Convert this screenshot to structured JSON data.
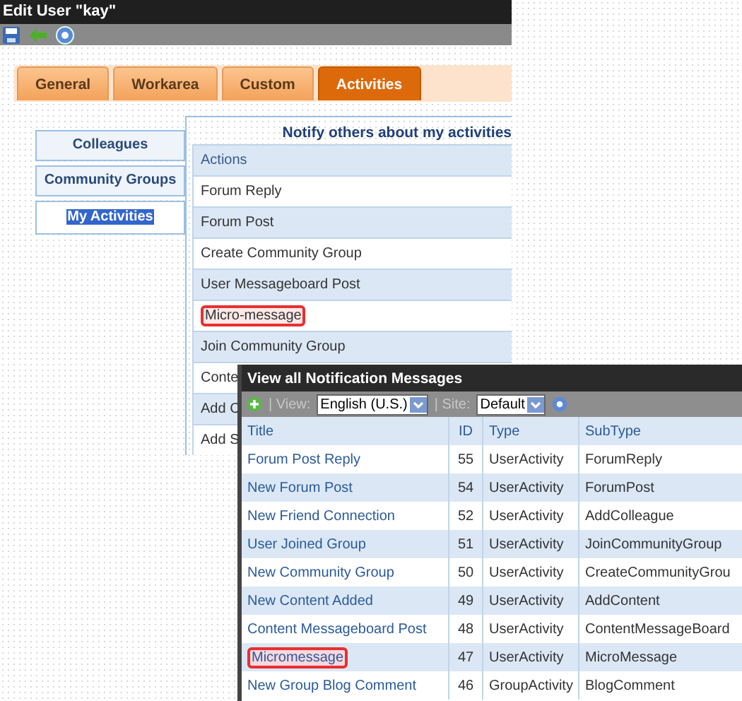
{
  "editor_window": {
    "title": "Edit User \"kay\"",
    "tabs": [
      {
        "label": "General",
        "selected": false
      },
      {
        "label": "Workarea",
        "selected": false
      },
      {
        "label": "Custom",
        "selected": false
      },
      {
        "label": "Activities",
        "selected": true
      }
    ],
    "sidebar": {
      "items": [
        {
          "label": "Colleagues",
          "selected": false
        },
        {
          "label": "Community Groups",
          "selected": false
        },
        {
          "label": "My Activities",
          "selected": true
        }
      ]
    },
    "panel": {
      "heading": "Notify others about my activities",
      "rows": [
        {
          "label": "Actions",
          "kind": "header",
          "highlighted": false
        },
        {
          "label": "Forum Reply",
          "kind": "item",
          "highlighted": false
        },
        {
          "label": "Forum Post",
          "kind": "item",
          "highlighted": false
        },
        {
          "label": "Create Community Group",
          "kind": "item",
          "highlighted": false
        },
        {
          "label": "User Messageboard Post",
          "kind": "item",
          "highlighted": false
        },
        {
          "label": "Micro-message",
          "kind": "item",
          "highlighted": true
        },
        {
          "label": "Join Community Group",
          "kind": "item",
          "highlighted": false
        },
        {
          "label": "Conte",
          "kind": "item",
          "highlighted": false
        },
        {
          "label": "Add C",
          "kind": "item",
          "highlighted": false
        },
        {
          "label": "Add S",
          "kind": "item",
          "highlighted": false
        }
      ]
    }
  },
  "messages_window": {
    "title": "View all Notification Messages",
    "toolbar": {
      "view_label": "| View:",
      "view_value": "English (U.S.)",
      "site_label": "| Site:",
      "site_value": "Default"
    },
    "table": {
      "columns": [
        "Title",
        "ID",
        "Type",
        "SubType"
      ],
      "rows": [
        {
          "title": "Forum Post Reply",
          "id": "55",
          "type": "UserActivity",
          "subtype": "ForumReply",
          "highlighted": false
        },
        {
          "title": "New Forum Post",
          "id": "54",
          "type": "UserActivity",
          "subtype": "ForumPost",
          "highlighted": false
        },
        {
          "title": "New Friend Connection",
          "id": "52",
          "type": "UserActivity",
          "subtype": "AddColleague",
          "highlighted": false
        },
        {
          "title": "User Joined Group",
          "id": "51",
          "type": "UserActivity",
          "subtype": "JoinCommunityGroup",
          "highlighted": false
        },
        {
          "title": "New Community Group",
          "id": "50",
          "type": "UserActivity",
          "subtype": "CreateCommunityGrou",
          "highlighted": false
        },
        {
          "title": "New Content Added",
          "id": "49",
          "type": "UserActivity",
          "subtype": "AddContent",
          "highlighted": false
        },
        {
          "title": "Content Messageboard Post",
          "id": "48",
          "type": "UserActivity",
          "subtype": "ContentMessageBoard",
          "highlighted": false
        },
        {
          "title": "Micromessage",
          "id": "47",
          "type": "UserActivity",
          "subtype": "MicroMessage",
          "highlighted": true
        },
        {
          "title": "New Group Blog Comment",
          "id": "46",
          "type": "GroupActivity",
          "subtype": "BlogComment",
          "highlighted": false
        }
      ]
    }
  }
}
